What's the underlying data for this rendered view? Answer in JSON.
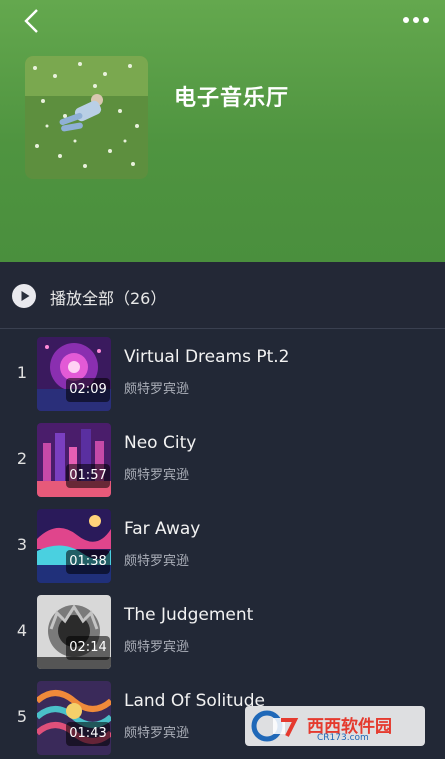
{
  "header": {
    "title": "电子音乐厅",
    "back_icon": "chevron-left-icon",
    "more_icon": "more-dots-icon"
  },
  "play_all": {
    "label": "播放全部（26）",
    "icon": "play-circle-icon"
  },
  "songs": [
    {
      "index": "1",
      "title": "Virtual Dreams Pt.2",
      "artist": "颇特罗宾逊",
      "duration": "02:09"
    },
    {
      "index": "2",
      "title": "Neo City",
      "artist": "颇特罗宾逊",
      "duration": "01:57"
    },
    {
      "index": "3",
      "title": "Far Away",
      "artist": "颇特罗宾逊",
      "duration": "01:38"
    },
    {
      "index": "4",
      "title": "The Judgement",
      "artist": "颇特罗宾逊",
      "duration": "02:14"
    },
    {
      "index": "5",
      "title": "Land Of Solitude",
      "artist": "颇特罗宾逊",
      "duration": "01:43"
    }
  ],
  "watermark": {
    "text": "西西软件园",
    "sub": "CR173.com"
  }
}
